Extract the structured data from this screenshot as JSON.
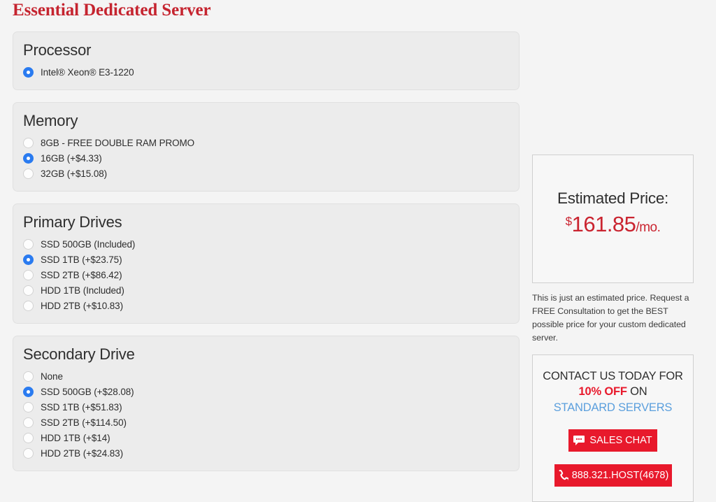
{
  "page": {
    "title": "Essential Dedicated Server",
    "title_color": "#c5242f",
    "background": "#f4f4f4"
  },
  "config": {
    "groups": [
      {
        "id": "processor",
        "title": "Processor",
        "options": [
          {
            "label": "Intel® Xeon® E3-1220",
            "selected": true
          }
        ]
      },
      {
        "id": "memory",
        "title": "Memory",
        "options": [
          {
            "label": "8GB - FREE DOUBLE RAM PROMO",
            "selected": false
          },
          {
            "label": "16GB (+$4.33)",
            "selected": true
          },
          {
            "label": "32GB (+$15.08)",
            "selected": false
          }
        ]
      },
      {
        "id": "primary-drives",
        "title": "Primary Drives",
        "options": [
          {
            "label": "SSD 500GB (Included)",
            "selected": false
          },
          {
            "label": "SSD 1TB (+$23.75)",
            "selected": true
          },
          {
            "label": "SSD 2TB (+$86.42)",
            "selected": false
          },
          {
            "label": "HDD 1TB (Included)",
            "selected": false
          },
          {
            "label": "HDD 2TB (+$10.83)",
            "selected": false
          }
        ]
      },
      {
        "id": "secondary-drive",
        "title": "Secondary Drive",
        "options": [
          {
            "label": "None",
            "selected": false
          },
          {
            "label": "SSD 500GB (+$28.08)",
            "selected": true
          },
          {
            "label": "SSD 1TB (+$51.83)",
            "selected": false
          },
          {
            "label": "SSD 2TB (+$114.50)",
            "selected": false
          },
          {
            "label": "HDD 1TB (+$14)",
            "selected": false
          },
          {
            "label": "HDD 2TB (+$24.83)",
            "selected": false
          }
        ]
      }
    ],
    "radio_selected_color": "#2a7bf0"
  },
  "sidebar": {
    "price": {
      "heading": "Estimated Price:",
      "currency": "$",
      "amount": "161.85",
      "period": "/mo.",
      "color": "#ca2430"
    },
    "disclaimer": "This is just an estimated price. Request a FREE Consultation to get the BEST possible price for your custom dedicated server.",
    "contact": {
      "line1": "CONTACT US TODAY FOR",
      "discount": "10% OFF",
      "on": " ON",
      "link": "STANDARD SERVERS",
      "link_color": "#5b9fdd",
      "discount_color": "#e8192c",
      "sales_chat_label": "SALES CHAT",
      "sales_chat_icon": "chat-bubble-icon",
      "phone_label": "888.321.HOST(4678)",
      "phone_icon": "phone-icon",
      "button_color": "#e8192c"
    }
  }
}
